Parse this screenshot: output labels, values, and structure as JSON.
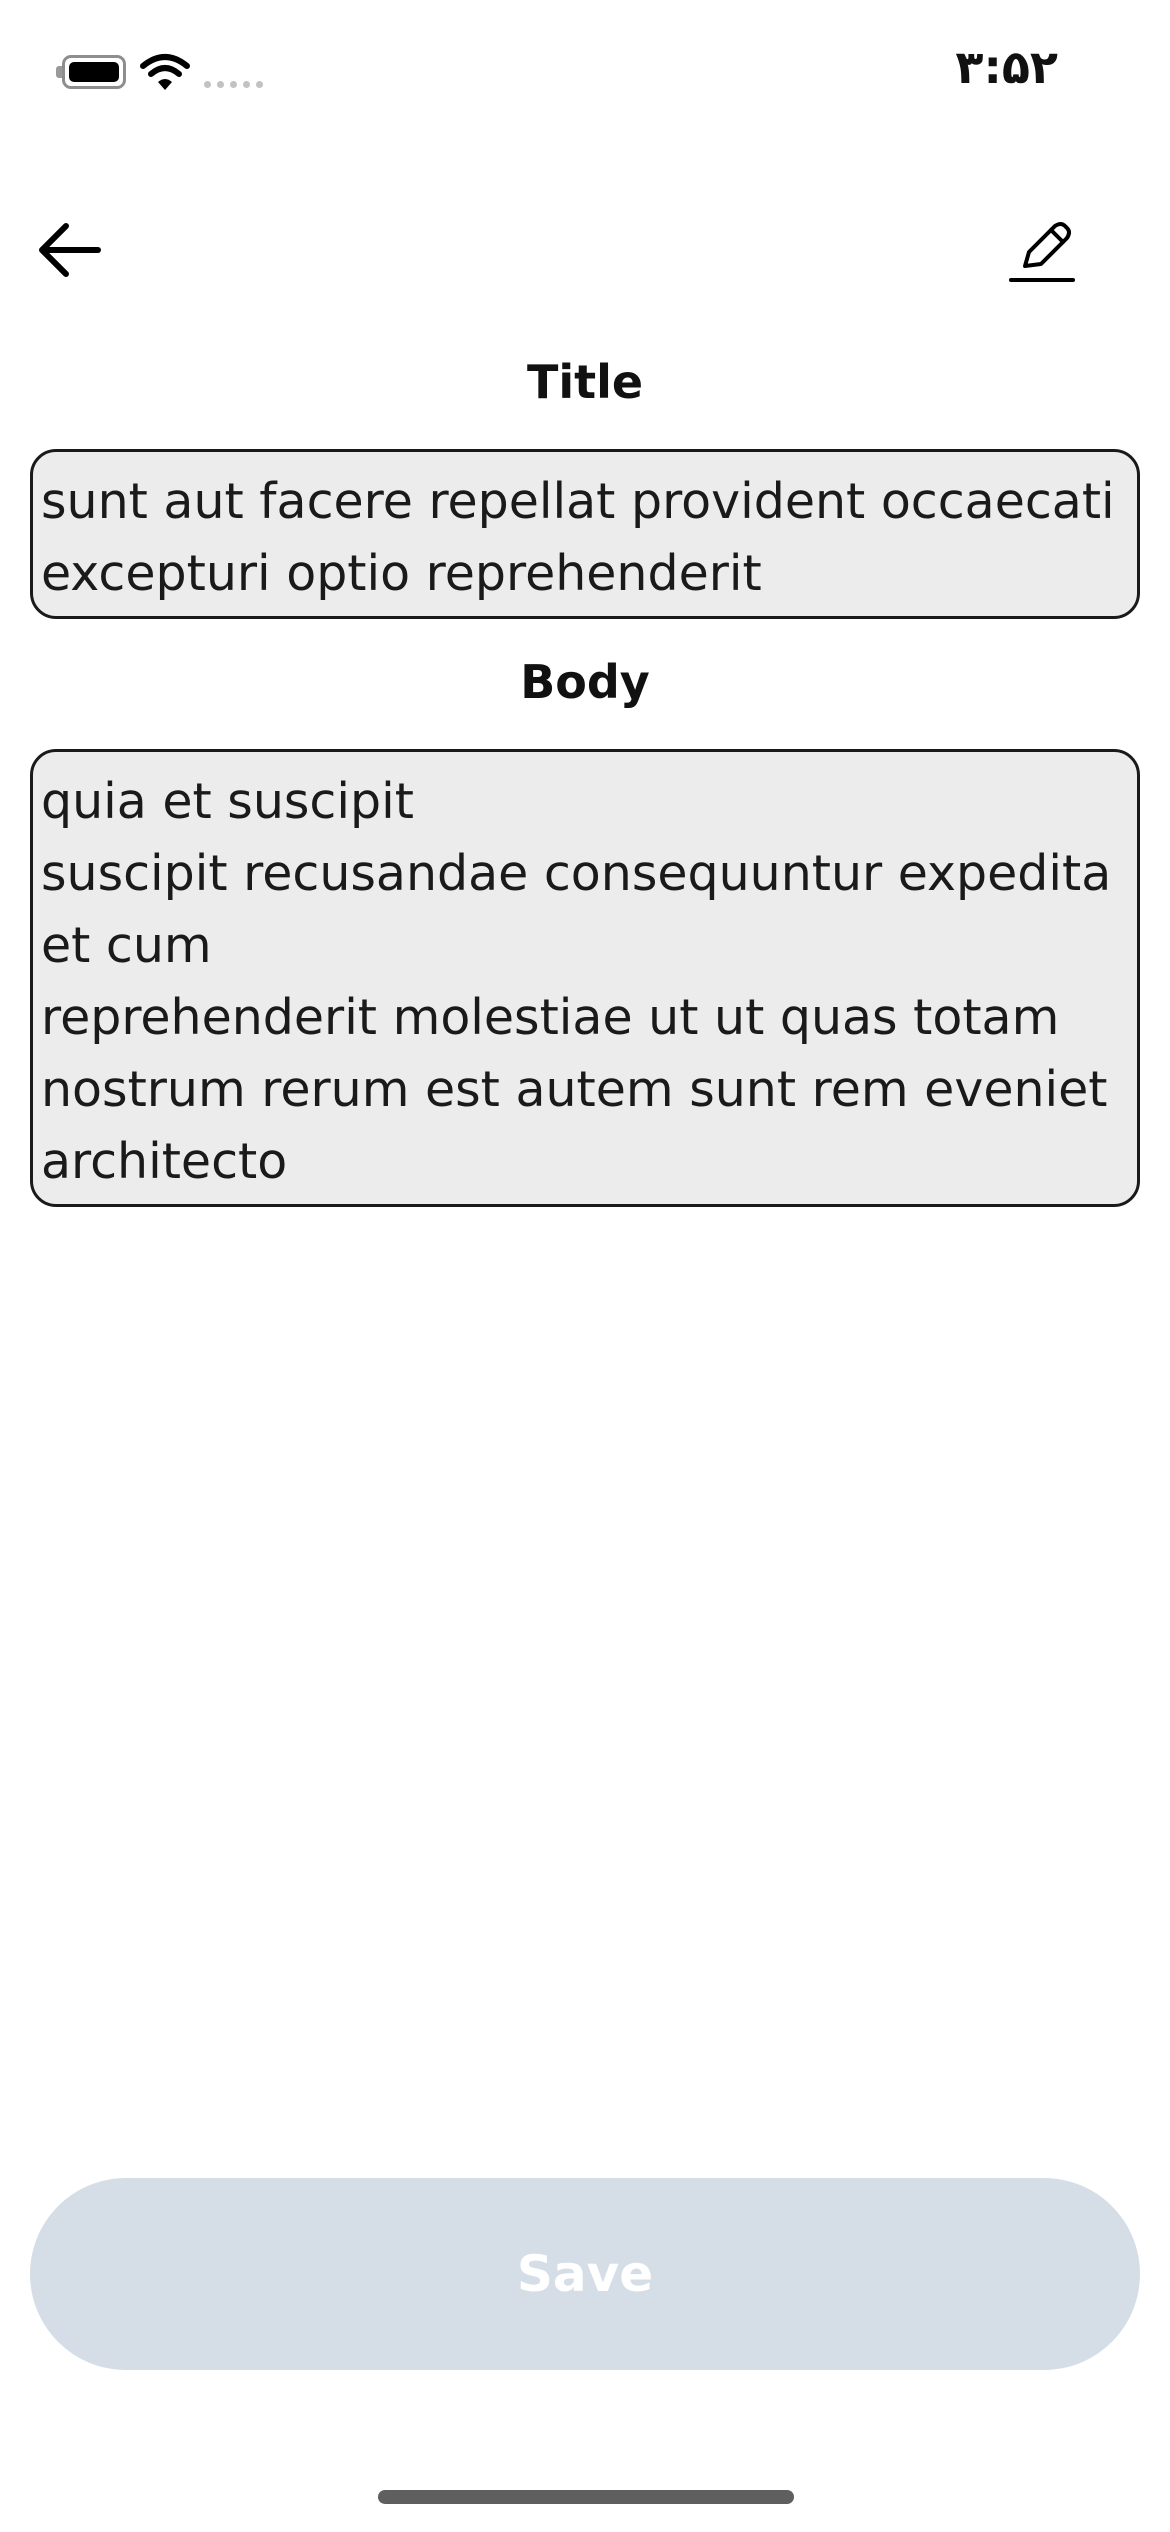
{
  "status_bar": {
    "time": "۳:۵۲",
    "battery_icon": "battery-icon",
    "wifi_icon": "wifi-icon",
    "signal_icon": "cellular-signal-dots-icon"
  },
  "nav": {
    "back_icon": "arrow-left-icon",
    "edit_icon": "pencil-edit-icon"
  },
  "form": {
    "title_label": "Title",
    "title_value": "sunt aut facere repellat provident occaecati excepturi optio reprehenderit",
    "body_label": "Body",
    "body_value": "quia et suscipit\nsuscipit recusandae consequuntur expedita et cum\nreprehenderit molestiae ut ut quas totam\nnostrum rerum est autem sunt rem eveniet architecto"
  },
  "actions": {
    "save_label": "Save"
  },
  "colors": {
    "field_background": "#ececec",
    "field_border": "#1a1a1a",
    "save_button_background": "#d5dee6",
    "save_button_text": "#ffffff"
  }
}
